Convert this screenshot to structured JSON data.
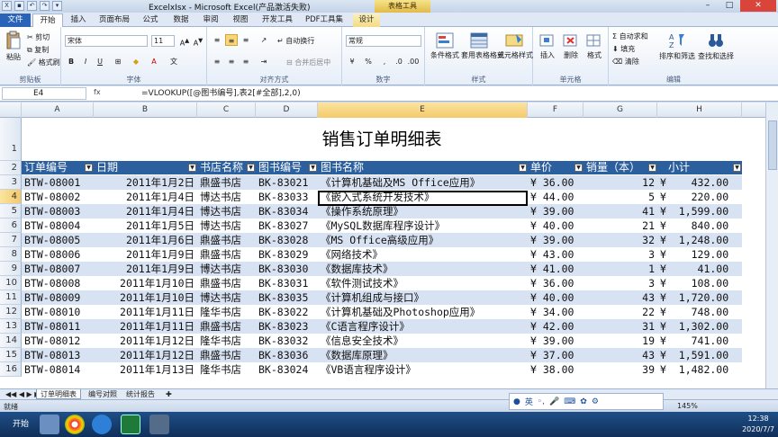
{
  "window": {
    "title": "ExcelxIsx - Microsoft Excel(产品激活失败)",
    "context_tab": "表格工具"
  },
  "ribbon_tabs": [
    "文件",
    "开始",
    "插入",
    "页面布局",
    "公式",
    "数据",
    "审阅",
    "视图",
    "开发工具",
    "PDF工具集",
    "设计"
  ],
  "clipboard": {
    "paste": "粘贴",
    "cut": "剪切",
    "copy": "复制",
    "painter": "格式刷",
    "label": "剪贴板"
  },
  "font": {
    "name": "宋体",
    "size": "11",
    "label": "字体",
    "bold": "B",
    "italic": "I",
    "underline": "U"
  },
  "align": {
    "wrap": "自动换行",
    "merge": "合并后居中",
    "label": "对齐方式"
  },
  "number": {
    "format": "常规",
    "label": "数字"
  },
  "styles": {
    "cond": "条件格式",
    "table": "套用表格格式",
    "cell": "单元格样式",
    "label": "样式"
  },
  "cells": {
    "insert": "插入",
    "delete": "删除",
    "format": "格式",
    "label": "单元格"
  },
  "editing": {
    "autosum": "自动求和",
    "fill": "填充",
    "clear": "清除",
    "sort": "排序和筛选",
    "find": "查找和选择",
    "label": "编辑"
  },
  "formula_bar": {
    "name_box": "E4",
    "fx": "fx",
    "formula": "=VLOOKUP([@图书编号],表2[#全部],2,0)"
  },
  "columns": [
    "A",
    "B",
    "C",
    "D",
    "E",
    "F",
    "G",
    "H"
  ],
  "sheet": {
    "title": "销售订单明细表",
    "headers": [
      "订单编号",
      "日期",
      "书店名称",
      "图书编号",
      "图书名称",
      "单价",
      "销量（本）",
      "小计"
    ],
    "rows": [
      [
        "BTW-08001",
        "2011年1月2日",
        "鼎盛书店",
        "BK-83021",
        "《计算机基础及MS Office应用》",
        "¥ 36.00",
        "12",
        "¥    432.00"
      ],
      [
        "BTW-08002",
        "2011年1月4日",
        "博达书店",
        "BK-83033",
        "《嵌入式系统开发技术》",
        "¥ 44.00",
        "5",
        "¥    220.00"
      ],
      [
        "BTW-08003",
        "2011年1月4日",
        "博达书店",
        "BK-83034",
        "《操作系统原理》",
        "¥ 39.00",
        "41",
        "¥  1,599.00"
      ],
      [
        "BTW-08004",
        "2011年1月5日",
        "博达书店",
        "BK-83027",
        "《MySQL数据库程序设计》",
        "¥ 40.00",
        "21",
        "¥    840.00"
      ],
      [
        "BTW-08005",
        "2011年1月6日",
        "鼎盛书店",
        "BK-83028",
        "《MS Office高级应用》",
        "¥ 39.00",
        "32",
        "¥  1,248.00"
      ],
      [
        "BTW-08006",
        "2011年1月9日",
        "鼎盛书店",
        "BK-83029",
        "《网络技术》",
        "¥ 43.00",
        "3",
        "¥    129.00"
      ],
      [
        "BTW-08007",
        "2011年1月9日",
        "博达书店",
        "BK-83030",
        "《数据库技术》",
        "¥ 41.00",
        "1",
        "¥     41.00"
      ],
      [
        "BTW-08008",
        "2011年1月10日",
        "鼎盛书店",
        "BK-83031",
        "《软件测试技术》",
        "¥ 36.00",
        "3",
        "¥    108.00"
      ],
      [
        "BTW-08009",
        "2011年1月10日",
        "博达书店",
        "BK-83035",
        "《计算机组成与接口》",
        "¥ 40.00",
        "43",
        "¥  1,720.00"
      ],
      [
        "BTW-08010",
        "2011年1月11日",
        "隆华书店",
        "BK-83022",
        "《计算机基础及Photoshop应用》",
        "¥ 34.00",
        "22",
        "¥    748.00"
      ],
      [
        "BTW-08011",
        "2011年1月11日",
        "鼎盛书店",
        "BK-83023",
        "《C语言程序设计》",
        "¥ 42.00",
        "31",
        "¥  1,302.00"
      ],
      [
        "BTW-08012",
        "2011年1月12日",
        "隆华书店",
        "BK-83032",
        "《信息安全技术》",
        "¥ 39.00",
        "19",
        "¥    741.00"
      ],
      [
        "BTW-08013",
        "2011年1月12日",
        "鼎盛书店",
        "BK-83036",
        "《数据库原理》",
        "¥ 37.00",
        "43",
        "¥  1,591.00"
      ],
      [
        "BTW-08014",
        "2011年1月13日",
        "隆华书店",
        "BK-83024",
        "《VB语言程序设计》",
        "¥ 38.00",
        "39",
        "¥  1,482.00"
      ]
    ]
  },
  "row_numbers": [
    "1",
    "2",
    "3",
    "4",
    "5",
    "6",
    "7",
    "8",
    "9",
    "10",
    "11",
    "12",
    "13",
    "14",
    "15",
    "16"
  ],
  "sheet_tabs": [
    "订单明细表",
    "编号对照",
    "统计报告"
  ],
  "status": {
    "ready": "就绪",
    "zoom": "145%"
  },
  "ime": {
    "lang": "英"
  },
  "taskbar": {
    "start": "开始",
    "time": "12:38",
    "date": "2020/7/7"
  }
}
